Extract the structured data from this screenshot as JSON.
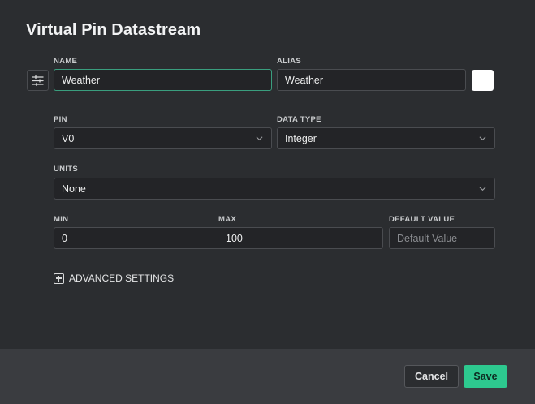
{
  "dialog": {
    "title": "Virtual Pin Datastream"
  },
  "name": {
    "label": "NAME",
    "value": "Weather"
  },
  "alias": {
    "label": "ALIAS",
    "value": "Weather"
  },
  "color": {
    "swatch": "#ffffff"
  },
  "pin": {
    "label": "PIN",
    "value": "V0"
  },
  "data_type": {
    "label": "DATA TYPE",
    "value": "Integer"
  },
  "units": {
    "label": "UNITS",
    "value": "None"
  },
  "min": {
    "label": "MIN",
    "value": "0"
  },
  "max": {
    "label": "MAX",
    "value": "100"
  },
  "default_value": {
    "label": "DEFAULT VALUE",
    "placeholder": "Default Value"
  },
  "advanced": {
    "label": "ADVANCED SETTINGS"
  },
  "footer": {
    "cancel_label": "Cancel",
    "save_label": "Save"
  },
  "colors": {
    "accent": "#2dc98f",
    "focus": "#3a9e7e",
    "background": "#2b2d30"
  },
  "icons": {
    "icon_picker": "sliders-icon",
    "dropdown": "chevron-down-icon",
    "expand": "plus-square-icon"
  }
}
